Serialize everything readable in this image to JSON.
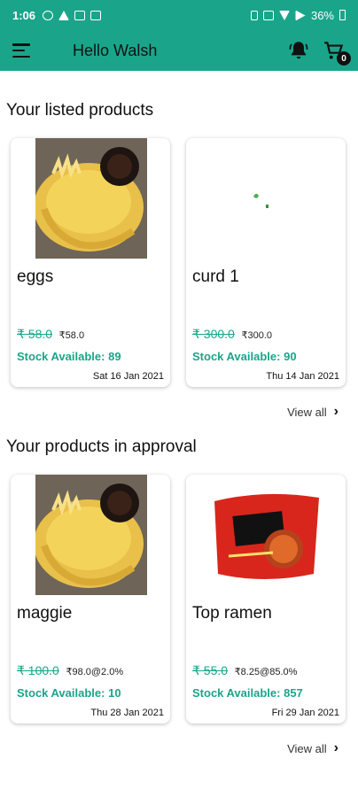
{
  "status_bar": {
    "time": "1:06",
    "battery": "36%"
  },
  "app_bar": {
    "title": "Hello Walsh",
    "cart_count": "0"
  },
  "listed": {
    "title": "Your listed products",
    "view_all": "View all",
    "items": [
      {
        "name": "eggs",
        "old_price": "₹ 58.0",
        "new_price": "₹58.0",
        "stock_label": "Stock Available:",
        "stock_value": "89",
        "date": "Sat 16 Jan 2021",
        "image": "cake"
      },
      {
        "name": "curd 1",
        "old_price": "₹ 300.0",
        "new_price": "₹300.0",
        "stock_label": "Stock Available:",
        "stock_value": "90",
        "date": "Thu 14 Jan 2021",
        "image": "sprout"
      }
    ]
  },
  "approval": {
    "title": "Your products in approval",
    "view_all": "View all",
    "items": [
      {
        "name": "maggie",
        "old_price": "₹ 100.0",
        "new_price": "₹98.0@2.0%",
        "stock_label": "Stock Available:",
        "stock_value": "10",
        "date": "Thu 28 Jan 2021",
        "image": "cake"
      },
      {
        "name": "Top ramen",
        "old_price": "₹ 55.0",
        "new_price": "₹8.25@85.0%",
        "stock_label": "Stock Available:",
        "stock_value": "857",
        "date": "Fri 29 Jan 2021",
        "image": "noodle-pack"
      }
    ]
  },
  "colors": {
    "accent": "#1aa58b"
  }
}
